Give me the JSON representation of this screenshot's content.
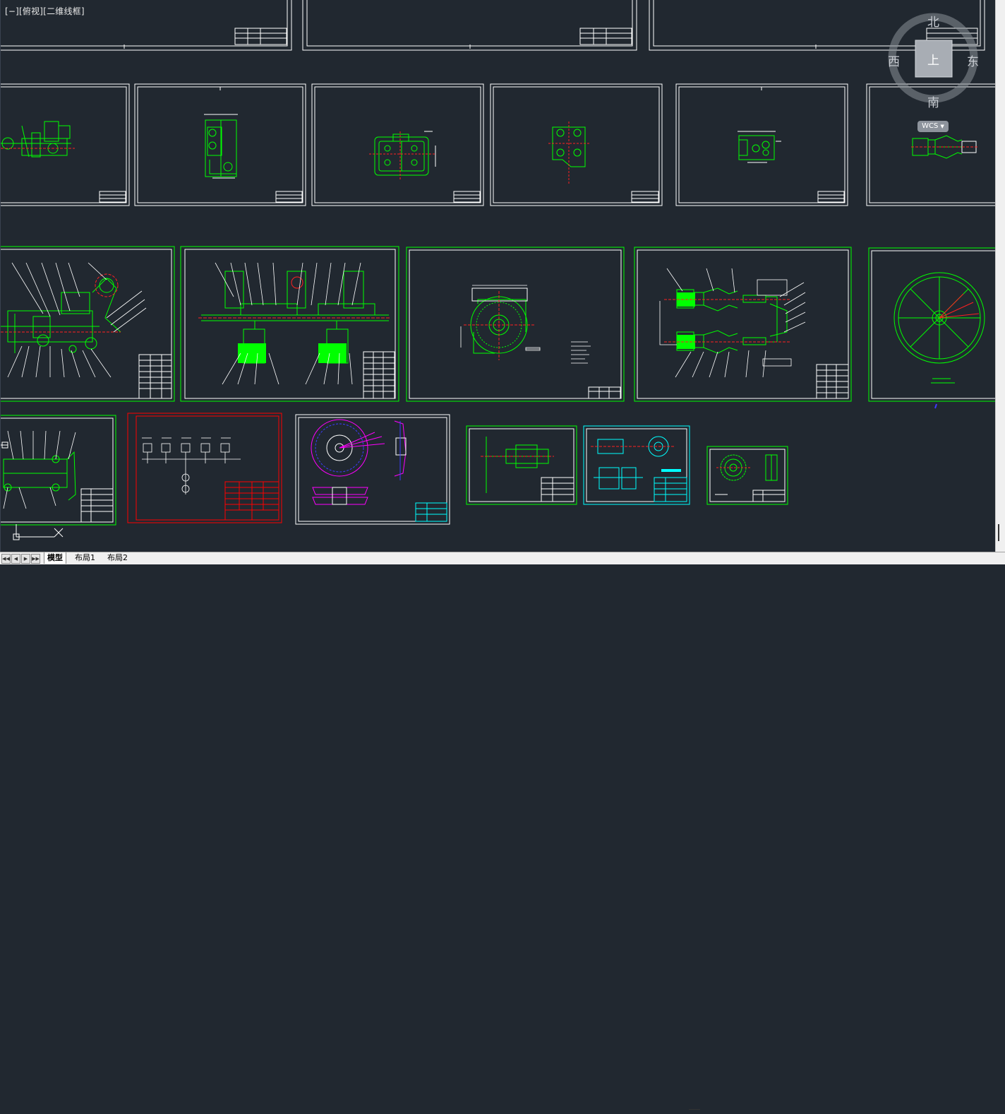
{
  "viewport": {
    "view_label": "[−][俯视][二维线框]",
    "ucs_icon": "ucs-axis-icon"
  },
  "viewcube": {
    "north": "北",
    "south": "南",
    "east": "东",
    "west": "西",
    "face": "上",
    "wcs_label": "WCS"
  },
  "layout_tabs": {
    "nav_icons": [
      "first-tab-icon",
      "prev-tab-icon",
      "next-tab-icon",
      "last-tab-icon"
    ],
    "tabs": [
      "模型",
      "布局1",
      "布局2"
    ],
    "active": "模型"
  },
  "colors": {
    "background": "#212830",
    "sheet_border": "#ffffff",
    "drawing_green": "#00ff00",
    "dimension_red": "#ff2020",
    "cyan_sheet": "#00ffff",
    "red_sheet": "#ff0000",
    "magenta": "#ff00ff",
    "blue": "#3c3cff"
  }
}
